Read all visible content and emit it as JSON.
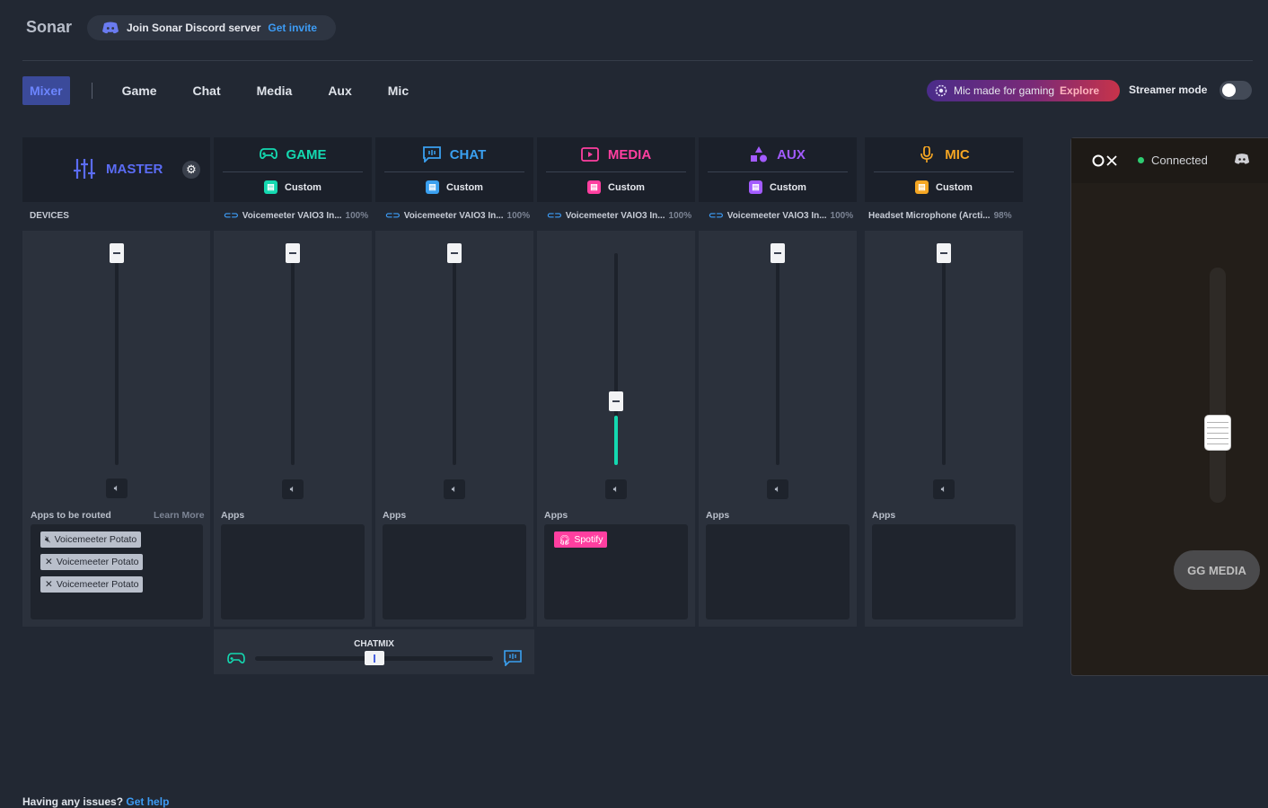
{
  "app": {
    "title": "Sonar"
  },
  "discord": {
    "text": "Join Sonar Discord server",
    "link": "Get invite",
    "icon": "discord-icon"
  },
  "tabs": [
    "Mixer",
    "Game",
    "Chat",
    "Media",
    "Aux",
    "Mic"
  ],
  "promo": {
    "text": "Mic made for gaming",
    "link": "Explore"
  },
  "streamer_mode": {
    "label": "Streamer mode",
    "enabled": false
  },
  "master": {
    "title": "MASTER",
    "devices_label": "DEVICES",
    "apps_label": "Apps to be routed",
    "learn_more": "Learn More",
    "apps": [
      "Voicemeeter Potato",
      "Voicemeeter Potato",
      "Voicemeeter Potato"
    ],
    "volume": 1.0
  },
  "channels": [
    {
      "name": "GAME",
      "preset": "Custom",
      "device": "Voicemeeter VAIO3 In...",
      "pct": "100%",
      "apps_label": "Apps",
      "apps": [],
      "volume": 1.0,
      "color": "#14d8b0"
    },
    {
      "name": "CHAT",
      "preset": "Custom",
      "device": "Voicemeeter VAIO3 In...",
      "pct": "100%",
      "apps_label": "Apps",
      "apps": [],
      "volume": 1.0,
      "color": "#3aa0f0"
    },
    {
      "name": "MEDIA",
      "preset": "Custom",
      "device": "Voicemeeter VAIO3 In...",
      "pct": "100%",
      "apps_label": "Apps",
      "apps": [
        "Spotify"
      ],
      "volume": 0.3,
      "color": "#ff3fa0"
    },
    {
      "name": "AUX",
      "preset": "Custom",
      "device": "Voicemeeter VAIO3 In...",
      "pct": "100%",
      "apps_label": "Apps",
      "apps": [],
      "volume": 1.0,
      "color": "#a35bff"
    },
    {
      "name": "MIC",
      "preset": "Custom",
      "device": "Headset Microphone (Arcti...",
      "pct": "98%",
      "apps_label": "Apps",
      "apps": [],
      "volume": 1.0,
      "color": "#f5a623"
    }
  ],
  "chatmix": {
    "label": "CHATMIX",
    "balance": 0.5
  },
  "gg_panel": {
    "status": "Connected",
    "button": "GG MEDIA",
    "volume": 0.4
  },
  "footer": {
    "text": "Having any issues?",
    "link": "Get help"
  }
}
